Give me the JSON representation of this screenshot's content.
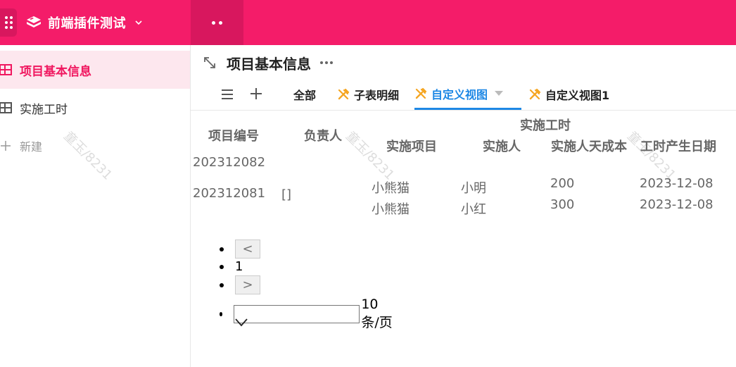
{
  "app": {
    "title": "前端插件测试",
    "accent_color": "#f41c69",
    "icons": [
      "apps-grid-icon",
      "app-logo-icon",
      "chevron-down-icon",
      "more-dots-icon"
    ]
  },
  "sidebar": {
    "items": [
      {
        "label": "项目基本信息",
        "icon": "table-icon",
        "active": true
      },
      {
        "label": "实施工时",
        "icon": "table-icon",
        "active": false
      },
      {
        "label": "新建",
        "icon": "plus-icon",
        "active": false
      }
    ]
  },
  "main": {
    "title": "项目基本信息",
    "tabs": [
      {
        "label": "全部"
      },
      {
        "label": "子表明细",
        "icon": "wrench-icon"
      },
      {
        "label": "自定义视图",
        "icon": "wrench-icon",
        "active": true
      },
      {
        "label": "自定义视图1",
        "icon": "wrench-icon"
      }
    ]
  },
  "table": {
    "headers": {
      "project_no": "项目编号",
      "owner": "负责人",
      "group": "实施工时",
      "item": "实施项目",
      "person": "实施人",
      "daily_cost": "实施人天成本",
      "date": "工时产生日期"
    },
    "rows": [
      {
        "project_no": "202312082",
        "owner": "",
        "sub": []
      },
      {
        "project_no": "202312081",
        "owner": "[]",
        "sub": [
          {
            "item": "小熊猫",
            "person": "小明",
            "daily_cost": "200",
            "date": "2023-12-08"
          },
          {
            "item": "小熊猫",
            "person": "小红",
            "daily_cost": "300",
            "date": "2023-12-08"
          }
        ]
      }
    ]
  },
  "pagination": {
    "prev": "<",
    "page": "1",
    "next": ">",
    "size_input_value": "",
    "page_size_label": "10 条/页"
  },
  "watermark": {
    "text": "童玉/8231"
  }
}
